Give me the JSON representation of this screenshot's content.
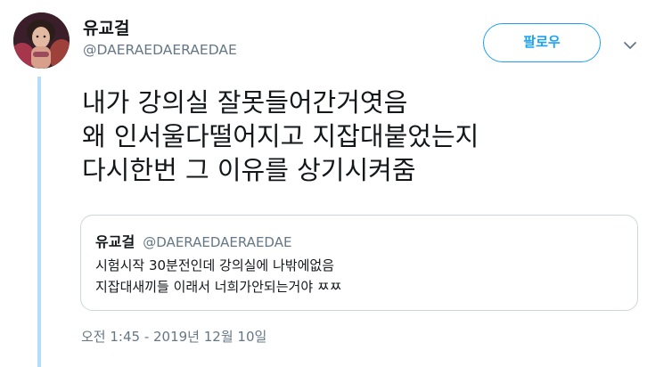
{
  "tweet": {
    "author": {
      "display_name": "유교걸",
      "handle": "@DAERAEDAERAEDAE"
    },
    "follow_label": "팔로우",
    "caret_icon": "chevron-down-icon",
    "text": "내가 강의실 잘못들어간거엿음\n왜 인서울다떨어지고 지잡대붙었는지\n다시한번 그 이유를 상기시켜줌",
    "timestamp": "오전 1:45 - 2019년 12월 10일"
  },
  "quoted_tweet": {
    "display_name": "유교걸",
    "handle": "@DAERAEDAERAEDAE",
    "text": "시험시작 30분전인데 강의실에 나밖에없음\n지잡대새끼들 이래서 너희가안되는거야 ㅉㅉ"
  },
  "colors": {
    "accent": "#1da1f2",
    "thread_line": "#b3ddf8",
    "secondary_text": "#657786",
    "border": "#ccd6dd"
  }
}
